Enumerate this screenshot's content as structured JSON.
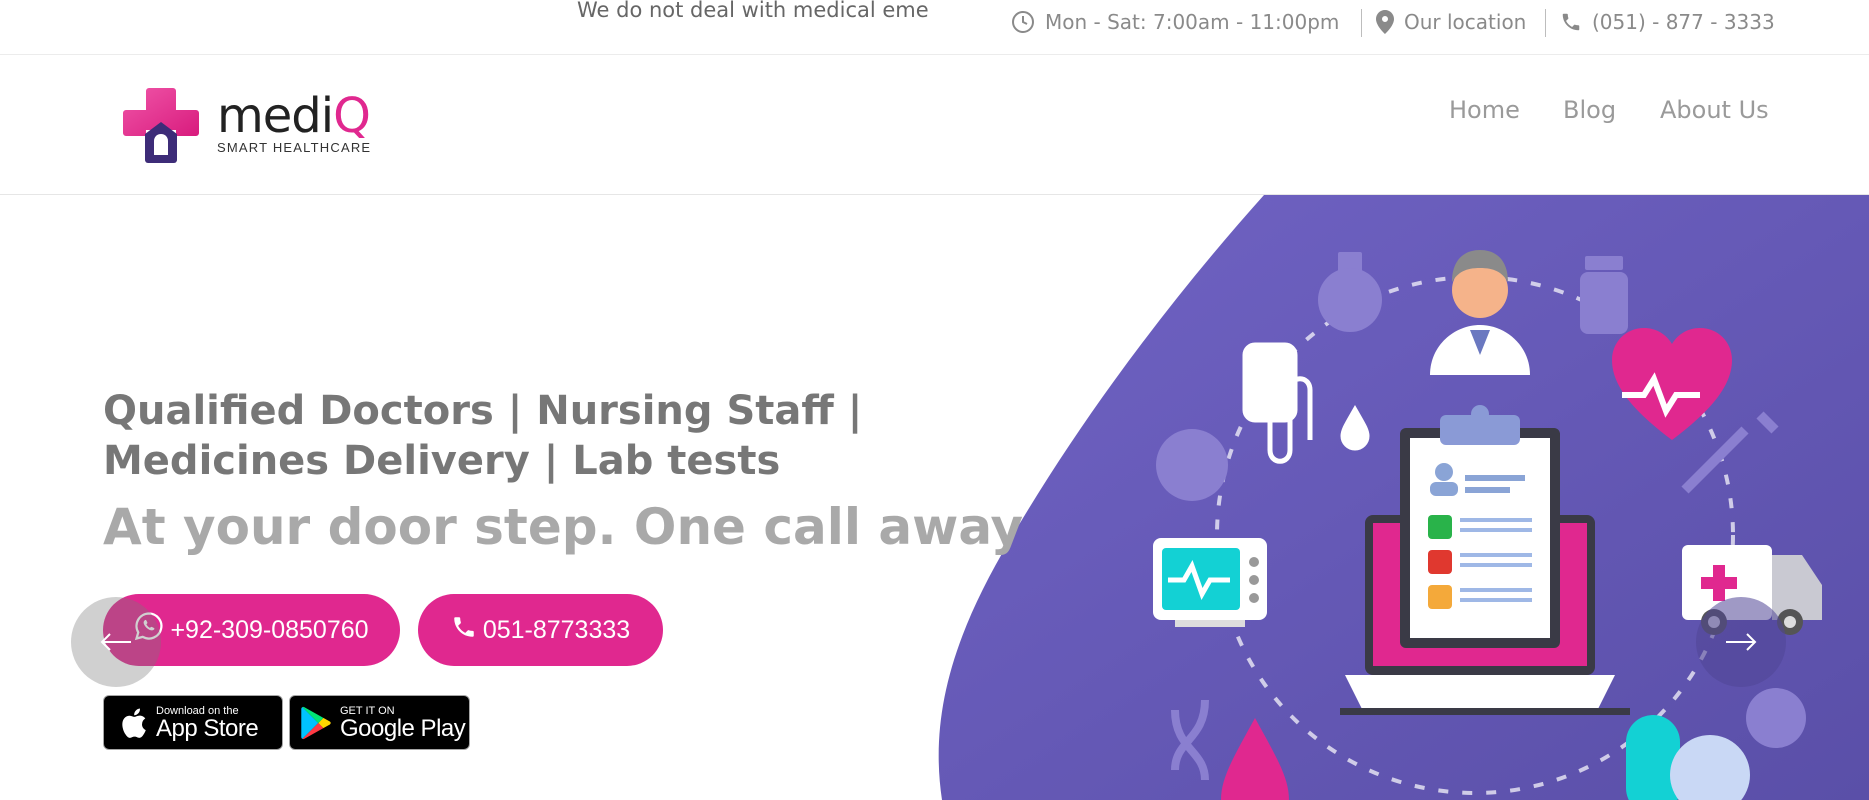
{
  "topbar": {
    "ticker": "We do not deal with medical eme",
    "hours": "Mon - Sat: 7:00am - 11:00pm",
    "location": "Our location",
    "phone": "(051) - 877 - 3333"
  },
  "logo": {
    "name_main": "medi",
    "name_accent": "Q",
    "tagline": "SMART HEALTHCARE"
  },
  "nav": {
    "items": [
      {
        "label": "Home"
      },
      {
        "label": "Blog"
      },
      {
        "label": "About Us"
      }
    ]
  },
  "hero": {
    "title": "Qualified Doctors | Nursing Staff | Medicines Delivery | Lab tests",
    "subtitle": "At your door step. One call away",
    "whatsapp_label": "+92-309-0850760",
    "call_label": "051-8773333",
    "app_store_small": "Download on the",
    "app_store_big": "App Store",
    "google_play_small": "GET IT ON",
    "google_play_big": "Google Play"
  },
  "colors": {
    "accent": "#e0288f",
    "purple": "#6a5cb8",
    "text_gray": "#777777"
  }
}
